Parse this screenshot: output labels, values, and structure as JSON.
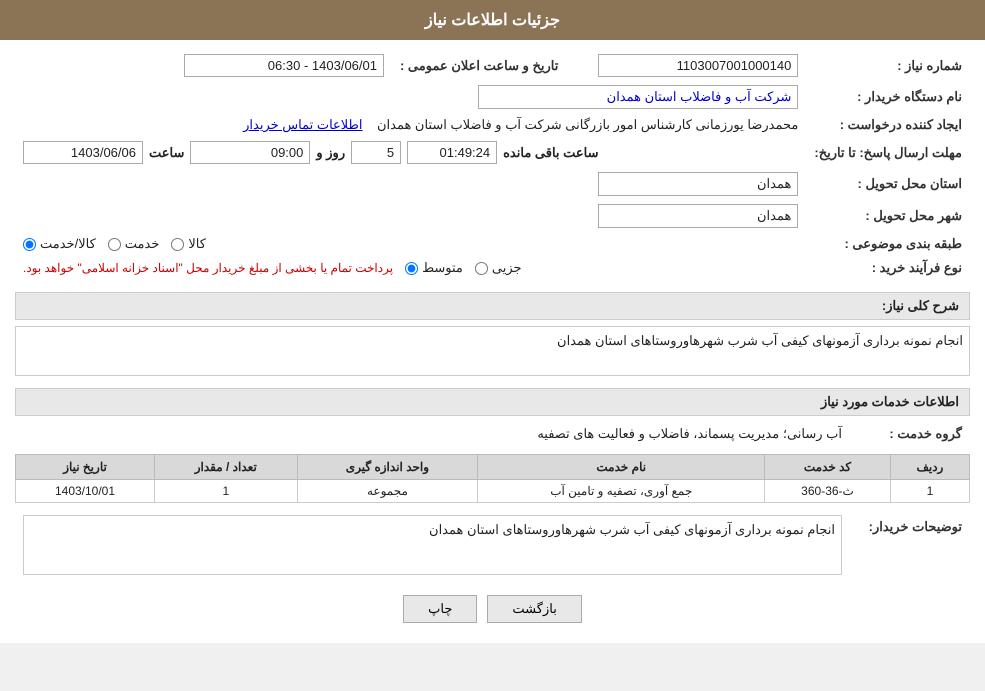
{
  "page": {
    "title": "جزئیات اطلاعات نیاز"
  },
  "fields": {
    "need_number_label": "شماره نیاز :",
    "need_number_value": "1103007001000140",
    "buyer_org_label": "نام دستگاه خریدار :",
    "buyer_org_value": "شرکت آب و فاضلاب استان همدان",
    "requester_label": "ایجاد کننده درخواست :",
    "requester_value": "محمدرضا یورزمانی کارشناس امور بازرگانی شرکت آب و فاضلاب استان همدان",
    "contact_link": "اطلاعات تماس خریدار",
    "announce_datetime_label": "تاریخ و ساعت اعلان عمومی :",
    "announce_datetime_value": "1403/06/01 - 06:30",
    "response_deadline_label": "مهلت ارسال پاسخ: تا تاریخ:",
    "response_date_value": "1403/06/06",
    "response_time_value": "09:00",
    "response_days_value": "5",
    "response_remaining_value": "01:49:24",
    "response_time_label": "ساعت",
    "response_days_label": "روز و",
    "response_remaining_label": "ساعت باقی مانده",
    "delivery_province_label": "استان محل تحویل :",
    "delivery_province_value": "همدان",
    "delivery_city_label": "شهر محل تحویل :",
    "delivery_city_value": "همدان",
    "category_label": "طبقه بندی موضوعی :",
    "category_options": [
      "کالا",
      "خدمت",
      "کالا/خدمت"
    ],
    "category_selected": "کالا/خدمت",
    "purchase_type_label": "نوع فرآیند خرید :",
    "purchase_type_options": [
      "جزیی",
      "متوسط"
    ],
    "purchase_type_notice": "پرداخت تمام یا بخشی از مبلغ خریدار محل \"اسناد خزانه اسلامی\" خواهد بود.",
    "general_desc_section": "شرح کلی نیاز:",
    "general_desc_value": "انجام نمونه برداری آزمونهای کیفی آب شرب شهرهاوروستاهای استان همدان",
    "service_info_section": "اطلاعات خدمات مورد نیاز",
    "service_group_label": "گروه خدمت :",
    "service_group_value": "آب رسانی؛ مدیریت پسماند، فاضلاب و فعالیت های تصفیه",
    "table_headers": [
      "ردیف",
      "کد خدمت",
      "نام خدمت",
      "واحد اندازه گیری",
      "تعداد / مقدار",
      "تاریخ نیاز"
    ],
    "table_rows": [
      {
        "row": "1",
        "code": "ث-36-360",
        "name": "جمع آوری، تصفیه و تامین آب",
        "unit": "مجموعه",
        "quantity": "1",
        "date": "1403/10/01"
      }
    ],
    "buyer_desc_section": "توضیحات خریدار:",
    "buyer_desc_value": "انجام نمونه برداری آزمونهای کیفی آب شرب شهرهاوروستاهای استان همدان",
    "btn_print": "چاپ",
    "btn_back": "بازگشت"
  }
}
